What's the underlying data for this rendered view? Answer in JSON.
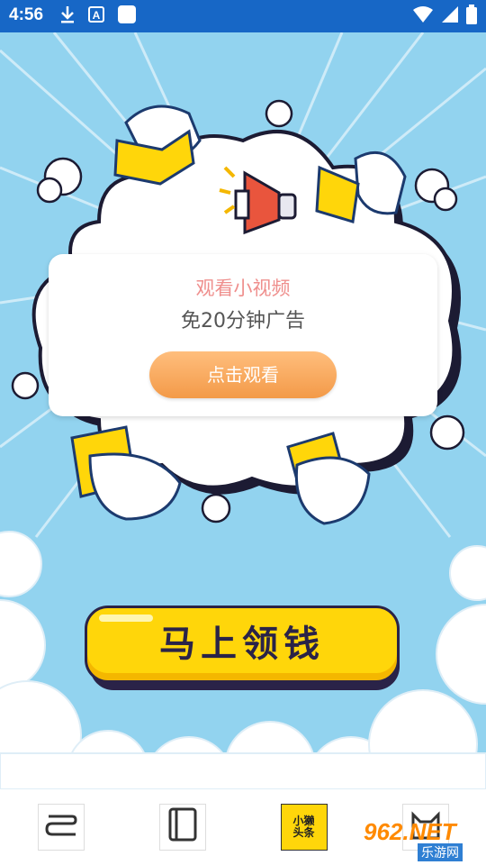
{
  "status_bar": {
    "time": "4:56",
    "left_icons": [
      "download-icon",
      "a-icon",
      "square-icon"
    ],
    "right_icons": [
      "wifi-icon",
      "signal-icon",
      "battery-icon"
    ],
    "background": "#1767c6"
  },
  "popup": {
    "title": "观看小视频",
    "subtitle": "免20分钟广告",
    "button_label": "点击观看"
  },
  "main": {
    "claim_button_label": "马上领钱"
  },
  "bottom_nav": {
    "items": [
      {
        "icon": "swirl-icon"
      },
      {
        "icon": "book-icon"
      },
      {
        "icon": "xiaolai-app-icon",
        "label_line1": "小獭",
        "label_line2": "头条"
      },
      {
        "icon": "cat-icon"
      }
    ]
  },
  "watermark": {
    "main": "962.NET",
    "sub": "乐游网"
  },
  "colors": {
    "sky": "#92d3ef",
    "popup_title": "#ef8f8d",
    "button_orange": "#f39a48",
    "claim_yellow": "#ffd60a",
    "outline": "#2a2348"
  }
}
